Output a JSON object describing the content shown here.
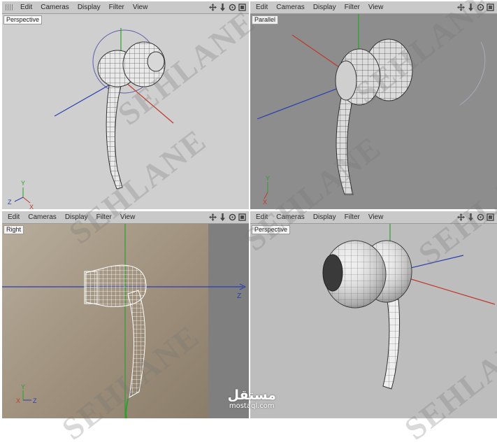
{
  "menu": [
    "Edit",
    "Cameras",
    "Display",
    "Filter",
    "View"
  ],
  "viewports": {
    "top_left": "Perspective",
    "top_right": "Parallel",
    "bottom_left": "Right",
    "bottom_right": "Perspective"
  },
  "axis": {
    "x": "X",
    "y": "Y",
    "z": "Z"
  },
  "watermark": "SEHLANE",
  "brand": {
    "arabic": "مستقل",
    "url": "mostaql.com"
  },
  "colors": {
    "x_axis": "#c0392b",
    "y_axis": "#2e9e2e",
    "z_axis": "#2b3fae",
    "bg_pane": "#bdbdbd"
  },
  "icons": [
    "move-icon",
    "zoom-icon",
    "rotate-icon",
    "maximize-icon"
  ]
}
